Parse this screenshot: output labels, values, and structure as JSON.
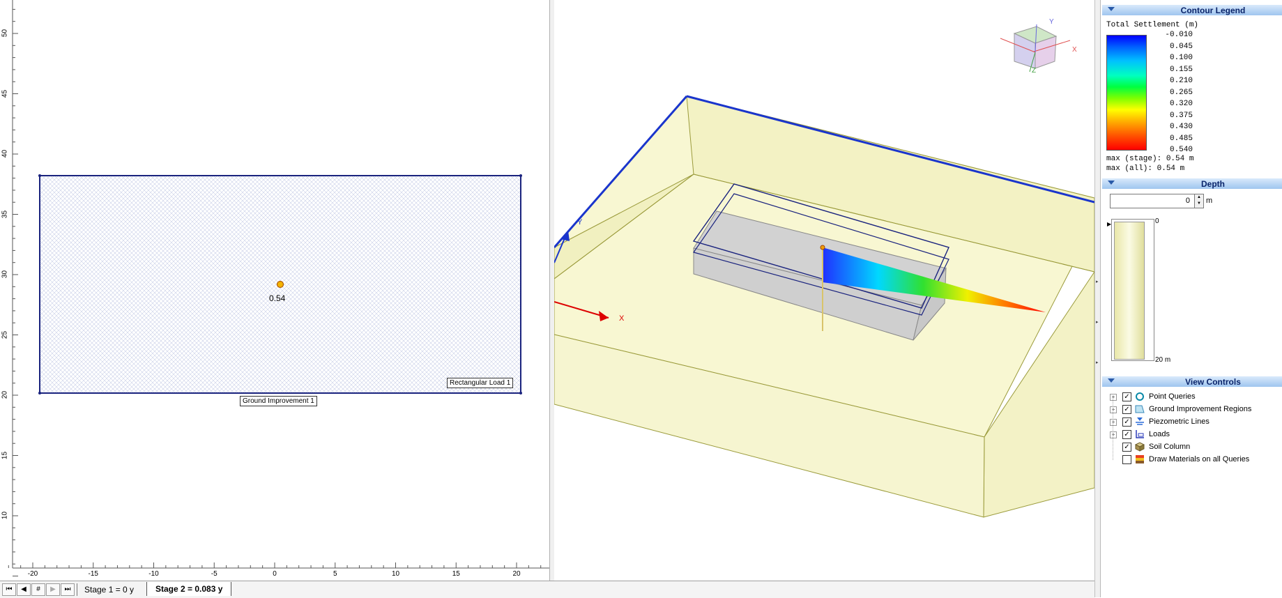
{
  "plan_view": {
    "x_ticks": [
      "-20",
      "-15",
      "-10",
      "-5",
      "0",
      "5",
      "10",
      "15",
      "20"
    ],
    "y_ticks": [
      "50",
      "45",
      "40",
      "35",
      "30",
      "25",
      "20",
      "15",
      "10"
    ],
    "query_point_value": "0.54",
    "load_label": "Rectangular Load 1",
    "ground_improvement_label": "Ground Improvement 1"
  },
  "view_3d": {
    "axis_x": "X",
    "axis_y": "Y",
    "cube_axis_x": "X",
    "cube_axis_y": "Y",
    "cube_axis_z": "Z"
  },
  "contour_legend": {
    "header": "Contour Legend",
    "title": "Total Settlement (m)",
    "values": [
      "-0.010",
      "0.045",
      "0.100",
      "0.155",
      "0.210",
      "0.265",
      "0.320",
      "0.375",
      "0.430",
      "0.485",
      "0.540"
    ],
    "max_stage": "max (stage): 0.54 m",
    "max_all": "max (all):   0.54 m"
  },
  "depth": {
    "header": "Depth",
    "value": "0",
    "unit": "m",
    "top_label": "0",
    "bottom_label": "20 m"
  },
  "view_controls": {
    "header": "View Controls",
    "items": [
      {
        "label": "Point Queries",
        "checked": true,
        "expandable": true
      },
      {
        "label": "Ground Improvement Regions",
        "checked": true,
        "expandable": true
      },
      {
        "label": "Piezometric Lines",
        "checked": true,
        "expandable": true
      },
      {
        "label": "Loads",
        "checked": true,
        "expandable": true
      },
      {
        "label": "Soil Column",
        "checked": true,
        "expandable": false
      },
      {
        "label": "Draw Materials on all Queries",
        "checked": false,
        "expandable": false
      }
    ]
  },
  "tabs": {
    "nav_first": "⏮",
    "nav_prev": "◀",
    "nav_hash": "#",
    "nav_next": "▶",
    "nav_last": "⏭",
    "stage1": "Stage 1 = 0 y",
    "stage2": "Stage 2 = 0.083 y"
  },
  "colors": {
    "accent": "#0a246a",
    "soil": "#f7f6cf",
    "outline": "#1a237e"
  }
}
